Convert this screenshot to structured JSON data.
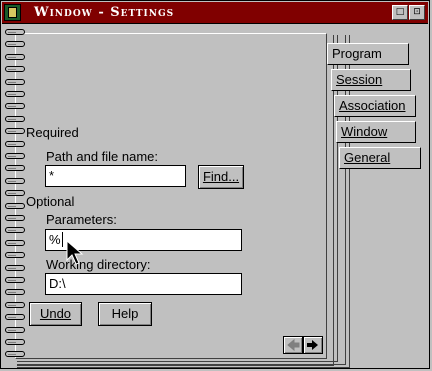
{
  "window": {
    "title": "Window - Settings",
    "restore_glyph": "□",
    "maximize_glyph": "⊡"
  },
  "tabs": [
    {
      "label": "Program"
    },
    {
      "label": "Session"
    },
    {
      "label": "Association"
    },
    {
      "label": "Window"
    },
    {
      "label": "General"
    }
  ],
  "page": {
    "required_heading": "Required",
    "path_label": "Path and file name:",
    "path_value": "*",
    "find_button": "Find...",
    "optional_heading": "Optional",
    "params_label": "Parameters:",
    "params_value": "%",
    "workdir_label": "Working directory:",
    "workdir_value": "D:\\",
    "undo_button": "Undo",
    "help_button": "Help"
  }
}
